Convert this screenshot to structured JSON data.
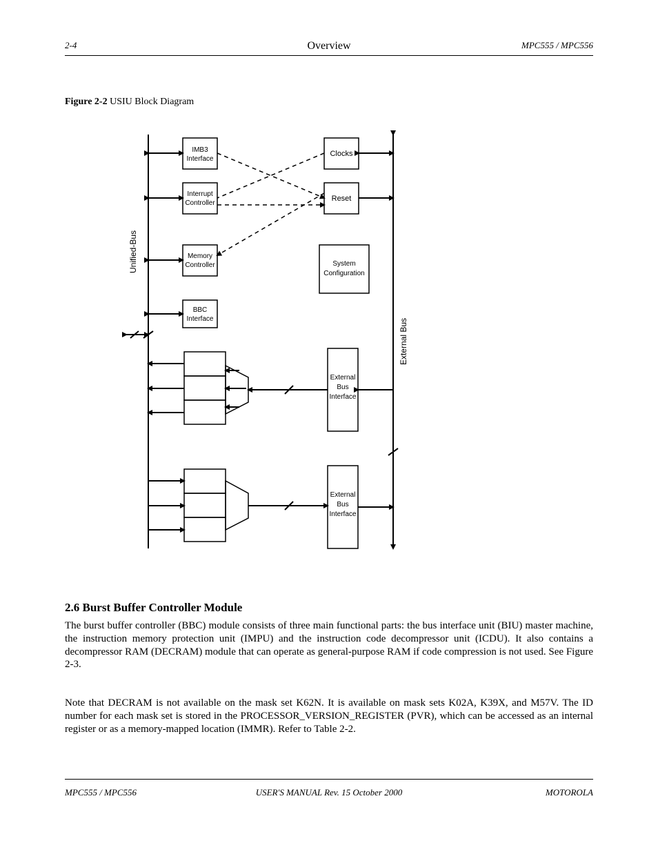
{
  "header": {
    "left": "2-4",
    "center": "Overview",
    "right": "MPC555 / MPC556"
  },
  "figure": {
    "caption_num": "Figure 2-2",
    "caption_text": "USIU Block Diagram",
    "blocks": {
      "imb3": "IMB3 Interface",
      "clocks": "Clocks",
      "reset": "Reset",
      "bbc": "BBC Interface",
      "interrupt": "Interrupt Controller",
      "memctrl": "Memory Controller",
      "sysconfig_l1": "System",
      "sysconfig_l2": "Configuration",
      "exbus_l1": "External",
      "exbus_l2": "Bus",
      "exbus_l3": "Interface"
    },
    "vertical_labels": {
      "left": "Unified-Bus",
      "right": "External Bus"
    },
    "section_title": "2.6  Burst Buffer Controller Module",
    "para1": "The burst buffer controller (BBC) module consists of three main functional parts: the bus interface unit (BIU) master machine, the instruction memory protection unit (IMPU) and the instruction code decompressor unit (ICDU). It also contains a decompressor RAM (DECRAM) module that can operate as general-purpose RAM if code compression is not used. See Figure 2-3.",
    "para2": "Note that DECRAM is not available on the mask set K62N. It is available on mask sets K02A, K39X, and M57V. The ID number for each mask set is stored in the PROCESSOR_VERSION_REGISTER (PVR), which can be accessed as an internal register or as a memory-mapped location (IMMR). Refer to Table 2-2."
  },
  "footer": {
    "left": "MPC555 / MPC556",
    "center": "USER'S MANUAL Rev. 15 October 2000",
    "right": "MOTOROLA"
  }
}
